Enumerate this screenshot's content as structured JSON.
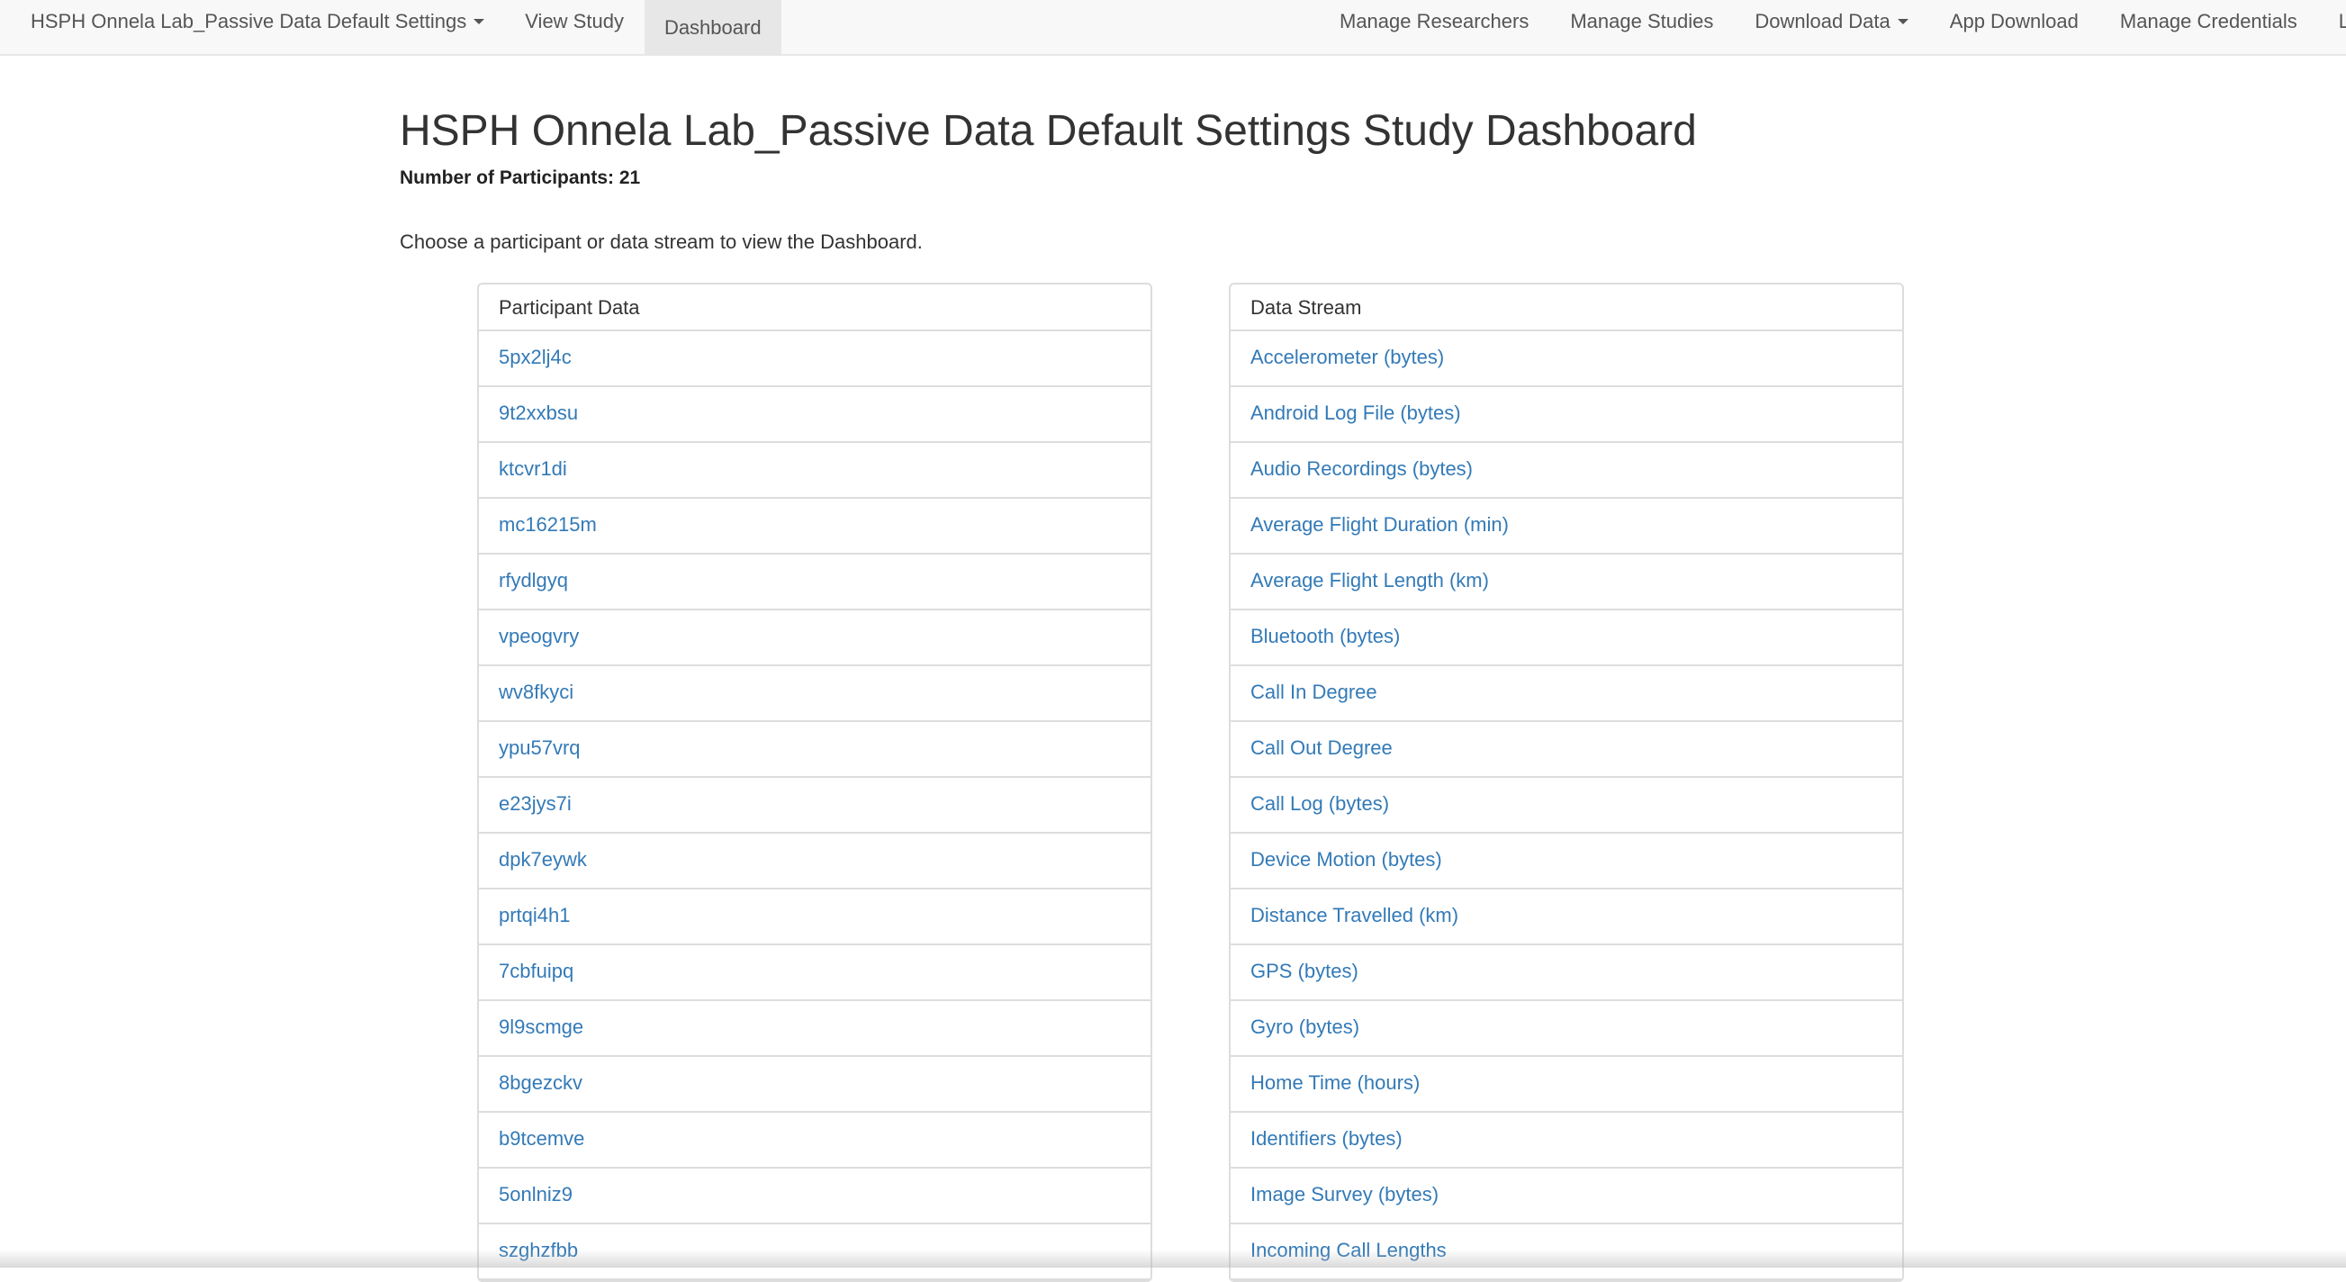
{
  "navbar": {
    "brand_label": "HSPH Onnela Lab_Passive Data Default Settings",
    "view_study_label": "View Study",
    "dashboard_label": "Dashboard",
    "manage_researchers_label": "Manage Researchers",
    "manage_studies_label": "Manage Studies",
    "download_data_label": "Download Data",
    "app_download_label": "App Download",
    "manage_credentials_label": "Manage Credentials",
    "logout_label": "Log O"
  },
  "header": {
    "title": "HSPH Onnela Lab_Passive Data Default Settings Study Dashboard",
    "participant_count": "Number of Participants: 21",
    "instruction": "Choose a participant or data stream to view the Dashboard."
  },
  "participant_panel": {
    "heading": "Participant Data",
    "items": [
      "5px2lj4c",
      "9t2xxbsu",
      "ktcvr1di",
      "mc16215m",
      "rfydlgyq",
      "vpeogvry",
      "wv8fkyci",
      "ypu57vrq",
      "e23jys7i",
      "dpk7eywk",
      "prtqi4h1",
      "7cbfuipq",
      "9l9scmge",
      "8bgezckv",
      "b9tcemve",
      "5onlniz9",
      "szghzfbb"
    ]
  },
  "data_stream_panel": {
    "heading": "Data Stream",
    "items": [
      "Accelerometer (bytes)",
      "Android Log File (bytes)",
      "Audio Recordings (bytes)",
      "Average Flight Duration (min)",
      "Average Flight Length (km)",
      "Bluetooth (bytes)",
      "Call In Degree",
      "Call Out Degree",
      "Call Log (bytes)",
      "Device Motion (bytes)",
      "Distance Travelled (km)",
      "GPS (bytes)",
      "Gyro (bytes)",
      "Home Time (hours)",
      "Identifiers (bytes)",
      "Image Survey (bytes)",
      "Incoming Call Lengths"
    ]
  },
  "colors": {
    "link": "#337ab7",
    "navbar_bg": "#f8f8f8",
    "navbar_active_bg": "#e7e7e7",
    "border": "#dddddd"
  }
}
